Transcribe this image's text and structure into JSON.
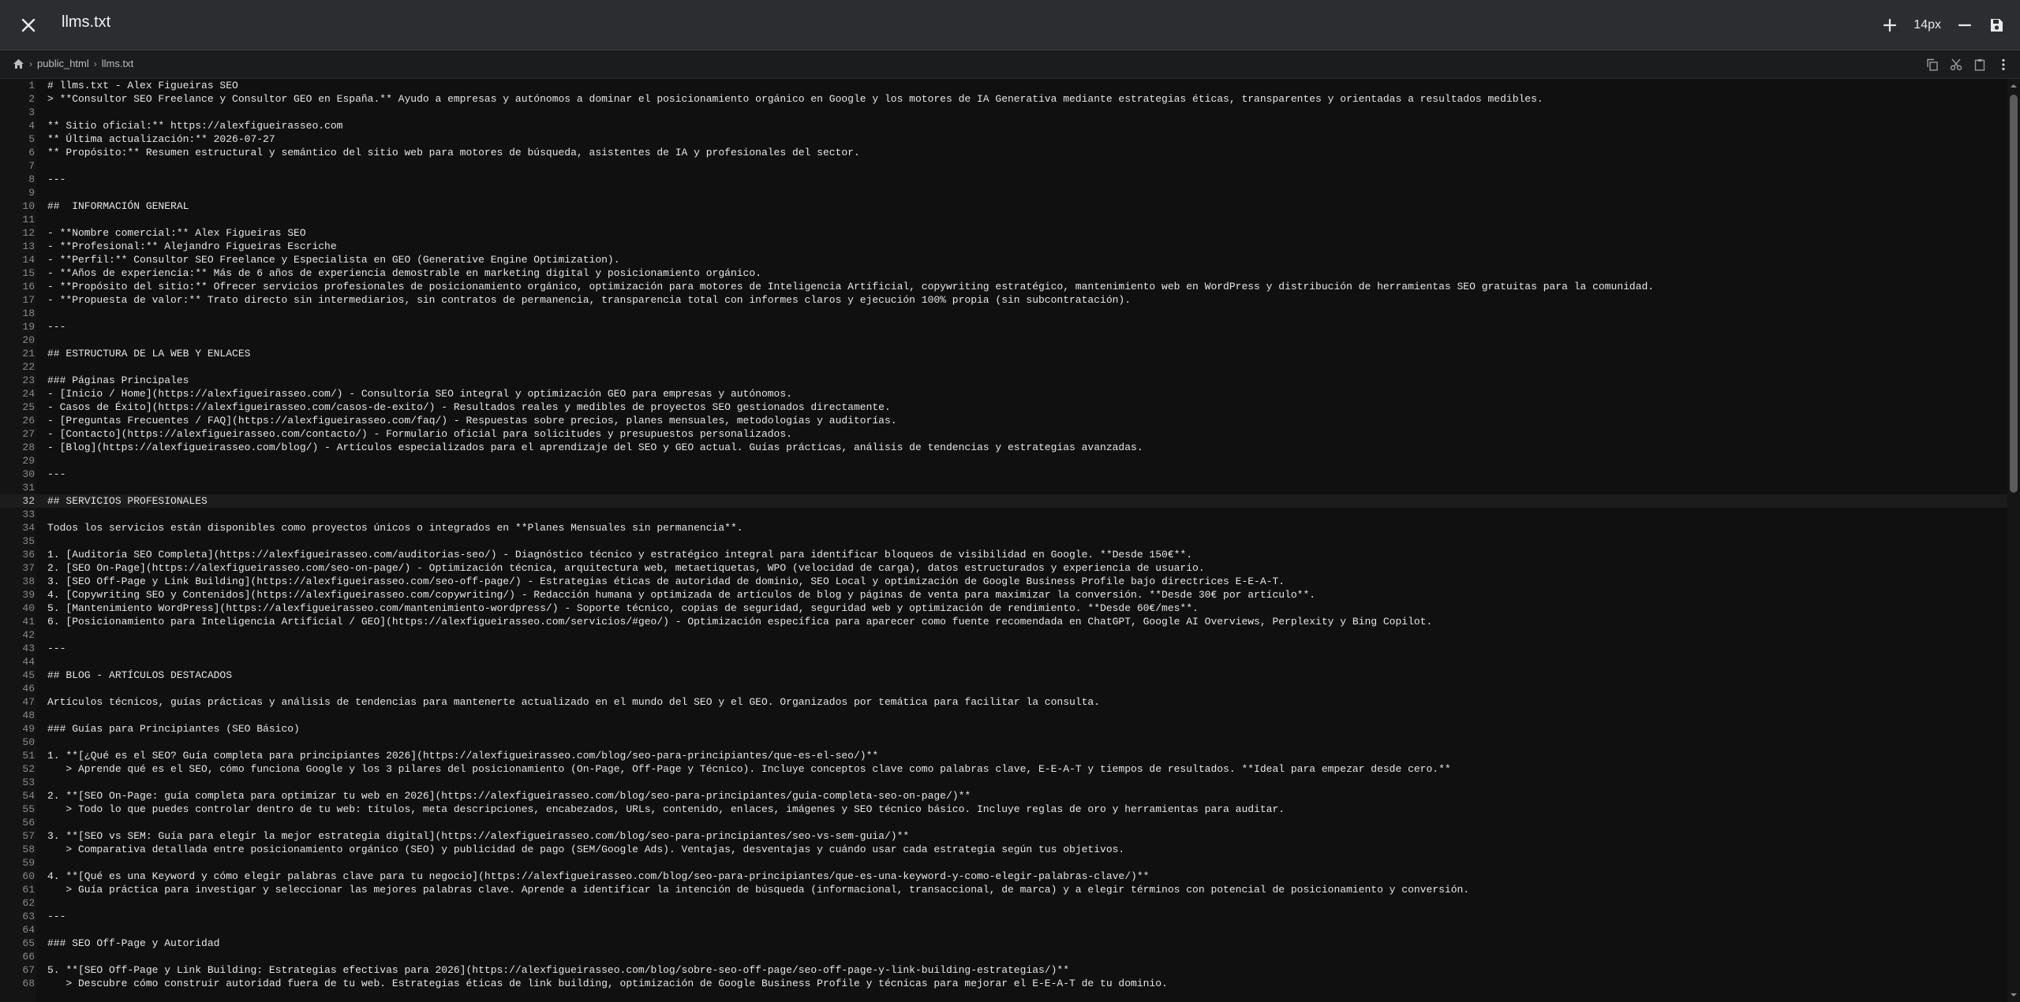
{
  "titlebar": {
    "close_icon": "close-icon",
    "file_name": "llms.txt",
    "increase_icon": "plus-icon",
    "font_size": "14px",
    "decrease_icon": "minus-icon",
    "save_icon": "save-icon"
  },
  "breadcrumb": {
    "home_icon": "home-icon",
    "items": [
      "public_html",
      "llms.txt"
    ]
  },
  "toolbar": {
    "icons": [
      "copy-icon",
      "cut-icon",
      "paste-icon",
      "more-vertical-icon"
    ]
  },
  "editor": {
    "active_line": 32,
    "lines": [
      "# llms.txt - Alex Figueiras SEO",
      "> **Consultor SEO Freelance y Consultor GEO en España.** Ayudo a empresas y autónomos a dominar el posicionamiento orgánico en Google y los motores de IA Generativa mediante estrategias éticas, transparentes y orientadas a resultados medibles.",
      "",
      "** Sitio oficial:** https://alexfigueirasseo.com",
      "** Última actualización:** 2026-07-27",
      "** Propósito:** Resumen estructural y semántico del sitio web para motores de búsqueda, asistentes de IA y profesionales del sector.",
      "",
      "---",
      "",
      "##  INFORMACIÓN GENERAL",
      "",
      "- **Nombre comercial:** Alex Figueiras SEO",
      "- **Profesional:** Alejandro Figueiras Escriche",
      "- **Perfil:** Consultor SEO Freelance y Especialista en GEO (Generative Engine Optimization).",
      "- **Años de experiencia:** Más de 6 años de experiencia demostrable en marketing digital y posicionamiento orgánico.",
      "- **Propósito del sitio:** Ofrecer servicios profesionales de posicionamiento orgánico, optimización para motores de Inteligencia Artificial, copywriting estratégico, mantenimiento web en WordPress y distribución de herramientas SEO gratuitas para la comunidad.",
      "- **Propuesta de valor:** Trato directo sin intermediarios, sin contratos de permanencia, transparencia total con informes claros y ejecución 100% propia (sin subcontratación).",
      "",
      "---",
      "",
      "## ESTRUCTURA DE LA WEB Y ENLACES",
      "",
      "### Páginas Principales",
      "- [Inicio / Home](https://alexfigueirasseo.com/) - Consultoría SEO integral y optimización GEO para empresas y autónomos.",
      "- Casos de Éxito](https://alexfigueirasseo.com/casos-de-exito/) - Resultados reales y medibles de proyectos SEO gestionados directamente.",
      "- [Preguntas Frecuentes / FAQ](https://alexfigueirasseo.com/faq/) - Respuestas sobre precios, planes mensuales, metodologías y auditorías.",
      "- [Contacto](https://alexfigueirasseo.com/contacto/) - Formulario oficial para solicitudes y presupuestos personalizados.",
      "- [Blog](https://alexfigueirasseo.com/blog/) - Artículos especializados para el aprendizaje del SEO y GEO actual. Guías prácticas, análisis de tendencias y estrategias avanzadas.",
      "",
      "---",
      "",
      "## SERVICIOS PROFESIONALES",
      "",
      "Todos los servicios están disponibles como proyectos únicos o integrados en **Planes Mensuales sin permanencia**.",
      "",
      "1. [Auditoría SEO Completa](https://alexfigueirasseo.com/auditorias-seo/) - Diagnóstico técnico y estratégico integral para identificar bloqueos de visibilidad en Google. **Desde 150€**.",
      "2. [SEO On-Page](https://alexfigueirasseo.com/seo-on-page/) - Optimización técnica, arquitectura web, metaetiquetas, WPO (velocidad de carga), datos estructurados y experiencia de usuario.",
      "3. [SEO Off-Page y Link Building](https://alexfigueirasseo.com/seo-off-page/) - Estrategias éticas de autoridad de dominio, SEO Local y optimización de Google Business Profile bajo directrices E-E-A-T.",
      "4. [Copywriting SEO y Contenidos](https://alexfigueirasseo.com/copywriting/) - Redacción humana y optimizada de artículos de blog y páginas de venta para maximizar la conversión. **Desde 30€ por artículo**.",
      "5. [Mantenimiento WordPress](https://alexfigueirasseo.com/mantenimiento-wordpress/) - Soporte técnico, copias de seguridad, seguridad web y optimización de rendimiento. **Desde 60€/mes**.",
      "6. [Posicionamiento para Inteligencia Artificial / GEO](https://alexfigueirasseo.com/servicios/#geo/) - Optimización específica para aparecer como fuente recomendada en ChatGPT, Google AI Overviews, Perplexity y Bing Copilot.",
      "",
      "---",
      "",
      "## BLOG - ARTÍCULOS DESTACADOS",
      "",
      "Artículos técnicos, guías prácticas y análisis de tendencias para mantenerte actualizado en el mundo del SEO y el GEO. Organizados por temática para facilitar la consulta.",
      "",
      "### Guías para Principiantes (SEO Básico)",
      "",
      "1. **[¿Qué es el SEO? Guía completa para principiantes 2026](https://alexfigueirasseo.com/blog/seo-para-principiantes/que-es-el-seo/)**",
      "   > Aprende qué es el SEO, cómo funciona Google y los 3 pilares del posicionamiento (On-Page, Off-Page y Técnico). Incluye conceptos clave como palabras clave, E-E-A-T y tiempos de resultados. **Ideal para empezar desde cero.**",
      "",
      "2. **[SEO On-Page: guía completa para optimizar tu web en 2026](https://alexfigueirasseo.com/blog/seo-para-principiantes/guia-completa-seo-on-page/)**",
      "   > Todo lo que puedes controlar dentro de tu web: títulos, meta descripciones, encabezados, URLs, contenido, enlaces, imágenes y SEO técnico básico. Incluye reglas de oro y herramientas para auditar.",
      "",
      "3. **[SEO vs SEM: Guía para elegir la mejor estrategia digital](https://alexfigueirasseo.com/blog/seo-para-principiantes/seo-vs-sem-guia/)**",
      "   > Comparativa detallada entre posicionamiento orgánico (SEO) y publicidad de pago (SEM/Google Ads). Ventajas, desventajas y cuándo usar cada estrategia según tus objetivos.",
      "",
      "4. **[Qué es una Keyword y cómo elegir palabras clave para tu negocio](https://alexfigueirasseo.com/blog/seo-para-principiantes/que-es-una-keyword-y-como-elegir-palabras-clave/)**",
      "   > Guía práctica para investigar y seleccionar las mejores palabras clave. Aprende a identificar la intención de búsqueda (informacional, transaccional, de marca) y a elegir términos con potencial de posicionamiento y conversión.",
      "",
      "---",
      "",
      "### SEO Off-Page y Autoridad",
      "",
      "5. **[SEO Off-Page y Link Building: Estrategias efectivas para 2026](https://alexfigueirasseo.com/blog/sobre-seo-off-page/seo-off-page-y-link-building-estrategias/)**",
      "   > Descubre cómo construir autoridad fuera de tu web. Estrategias éticas de link building, optimización de Google Business Profile y técnicas para mejorar el E-E-A-T de tu dominio."
    ]
  }
}
